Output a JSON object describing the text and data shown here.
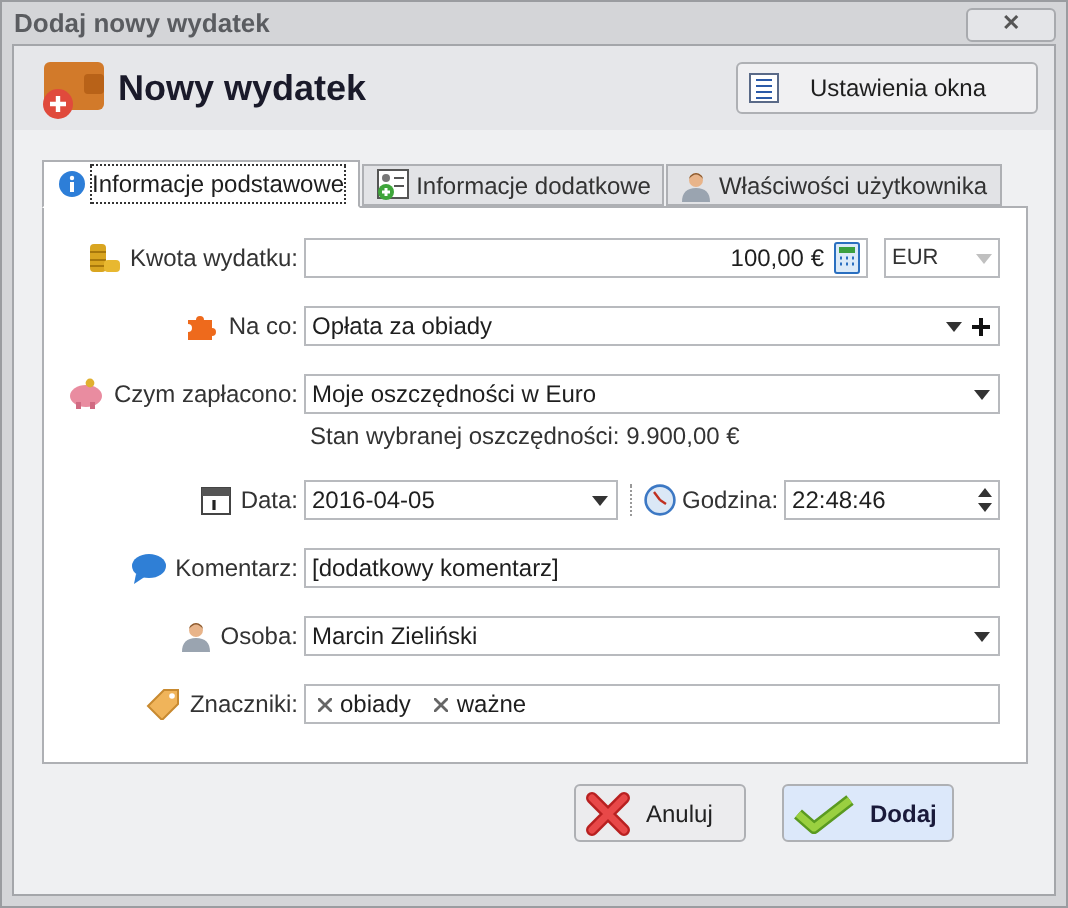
{
  "window": {
    "title": "Dodaj nowy wydatek",
    "close": "✕"
  },
  "header": {
    "title": "Nowy wydatek",
    "settings_button": "Ustawienia okna"
  },
  "tabs": [
    {
      "label": "Informacje podstawowe",
      "selected": true
    },
    {
      "label": "Informacje dodatkowe",
      "selected": false
    },
    {
      "label": "Właściwości użytkownika",
      "selected": false
    }
  ],
  "fields": [
    {
      "kind": "amount",
      "label": "Kwota wydatku:",
      "value": "100,00 €",
      "currency": {
        "value": "EUR",
        "disabled": true
      }
    },
    {
      "kind": "select_add",
      "label": "Na co:",
      "value": "Opłata za obiady"
    },
    {
      "kind": "select",
      "label": "Czym zapłacono:",
      "value": "Moje oszczędności w Euro",
      "note": "Stan wybranej oszczędności: 9.900,00 €"
    },
    {
      "kind": "datetime",
      "label": "Data:",
      "value": "2016-04-05",
      "time_label": "Godzina:",
      "time": "22:48:46"
    },
    {
      "kind": "text",
      "label": "Komentarz:",
      "value": "[dodatkowy komentarz]"
    },
    {
      "kind": "select",
      "label": "Osoba:",
      "value": "Marcin Zieliński"
    },
    {
      "kind": "tags",
      "label": "Znaczniki:",
      "tags": [
        "obiady",
        "ważne"
      ]
    }
  ],
  "buttons": [
    {
      "kind": "cancel",
      "label": "Anuluj",
      "default": false
    },
    {
      "kind": "confirm",
      "label": "Dodaj",
      "default": true
    }
  ]
}
